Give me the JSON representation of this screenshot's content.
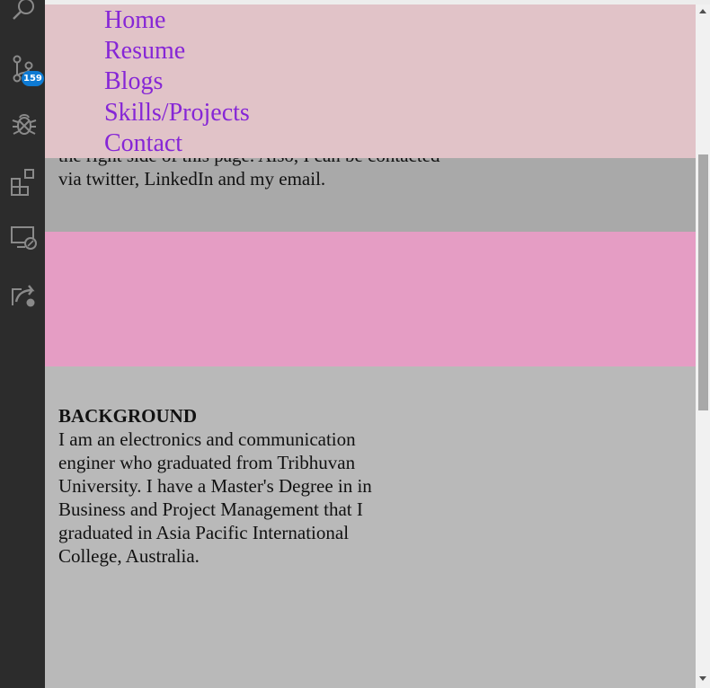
{
  "activity_bar": {
    "icons": [
      "search-icon",
      "source-control-icon",
      "debug-icon",
      "extensions-icon",
      "remote-explorer-icon",
      "live-share-icon"
    ],
    "source_control_badge": "159"
  },
  "nav": {
    "items": [
      "Home",
      "Resume",
      "Blogs",
      "Skills/Projects",
      "Contact"
    ]
  },
  "intro": {
    "text": "the right side of this page. Also, I can be contacted via twitter, LinkedIn and my email."
  },
  "background": {
    "title": "BACKGROUND",
    "text": "I am an electronics and communication enginer who graduated from Tribhuvan University. I have a Master's Degree in in Business and Project Management that I graduated in Asia Pacific International College, Australia."
  },
  "colors": {
    "navbar_bg": "#e1c3c8",
    "nav_link": "#8626d6",
    "intro_bg": "#a9a9a9",
    "pink_section": "#e59dc4",
    "background_section": "#b9b9b9",
    "badge": "#0e7ad3"
  }
}
